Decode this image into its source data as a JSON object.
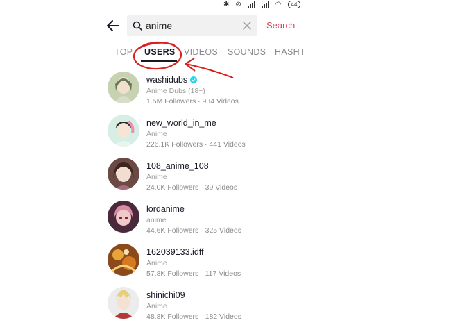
{
  "status_bar": {
    "battery": "44"
  },
  "search": {
    "query": "anime",
    "button_label": "Search"
  },
  "tabs": [
    {
      "label": "TOP",
      "active": false
    },
    {
      "label": "USERS",
      "active": true
    },
    {
      "label": "VIDEOS",
      "active": false
    },
    {
      "label": "SOUNDS",
      "active": false
    },
    {
      "label": "HASHT",
      "active": false
    }
  ],
  "users": [
    {
      "username": "washidubs",
      "verified": true,
      "subtitle": "Anime Dubs (18+)",
      "stats": "1.5M Followers · 934 Videos"
    },
    {
      "username": "new_world_in_me",
      "verified": false,
      "subtitle": "Anime",
      "stats": "226.1K Followers · 441 Videos"
    },
    {
      "username": "108_anime_108",
      "verified": false,
      "subtitle": "Anime",
      "stats": "24.0K Followers · 39 Videos"
    },
    {
      "username": "lordanime",
      "verified": false,
      "subtitle": "anime",
      "stats": "44.6K Followers · 325 Videos"
    },
    {
      "username": "162039133.idff",
      "verified": false,
      "subtitle": "Anime",
      "stats": "57.8K Followers · 117 Videos"
    },
    {
      "username": "shinichi09",
      "verified": false,
      "subtitle": "Anime",
      "stats": "48.8K Followers · 182 Videos"
    }
  ],
  "colors": {
    "accent": "#e0425d",
    "annotation": "#d92020",
    "verified": "#20d5ec"
  }
}
